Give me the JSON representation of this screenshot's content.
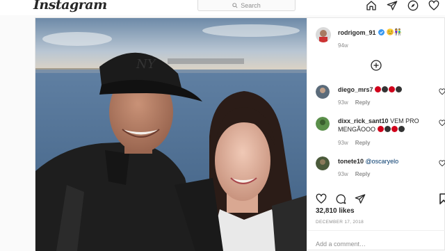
{
  "header": {
    "logo": "Instagram",
    "search_placeholder": "Search",
    "icons": [
      "home-icon",
      "direct-icon",
      "explore-icon",
      "activity-heart-icon"
    ]
  },
  "post": {
    "author": "rodrigom_91",
    "verified": true,
    "caption_emojis": "😊👫",
    "caption_time": "94w",
    "load_more_icon": "plus-circle-icon",
    "comments": [
      {
        "user": "diego_mrs7",
        "text": "",
        "time": "93w",
        "reply": "Reply"
      },
      {
        "user": "dixx_rick_sant10",
        "text": "VEM PRO MENGÃOOO",
        "time": "93w",
        "reply": "Reply"
      },
      {
        "user": "tonete10",
        "text": "@oscaryelo",
        "time": "93w",
        "reply": "Reply"
      }
    ],
    "likes": "32,810 likes",
    "date": "DECEMBER 17, 2018",
    "add_comment_placeholder": "Add a comment…"
  },
  "colors": {
    "verified": "#3897f0",
    "emoji_red": "#d0021b",
    "emoji_black": "#333333"
  }
}
